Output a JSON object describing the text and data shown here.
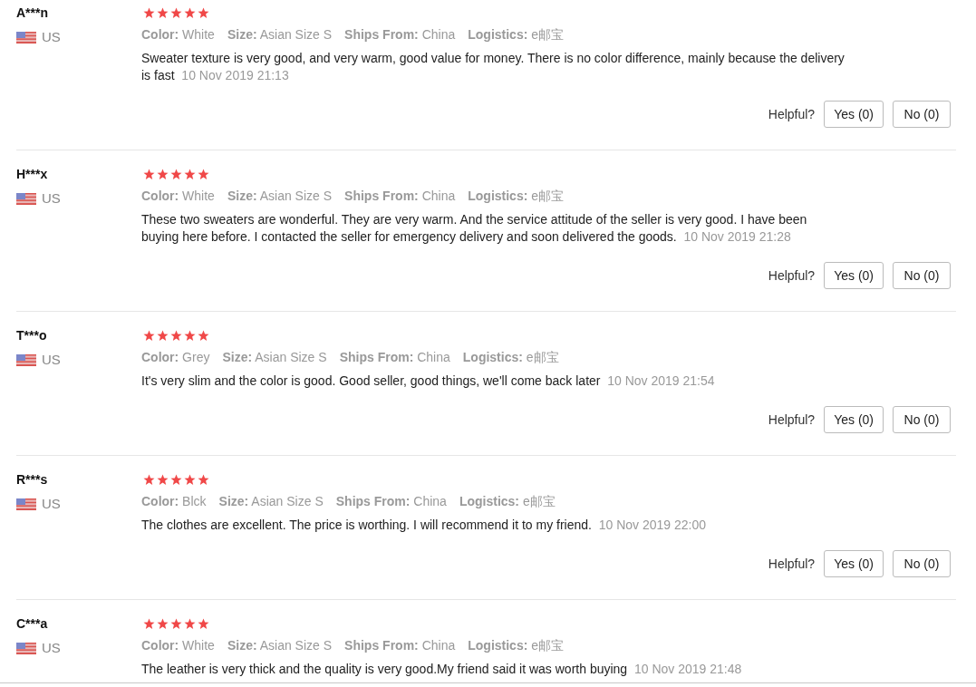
{
  "reviews": [
    {
      "name": "A***n",
      "country": "US",
      "stars": 5,
      "attributes": [
        {
          "label": "Color:",
          "value": "White"
        },
        {
          "label": "Size:",
          "value": "Asian Size S"
        },
        {
          "label": "Ships From:",
          "value": "China"
        },
        {
          "label": "Logistics:",
          "value": "e邮宝"
        }
      ],
      "text": "Sweater texture is very good, and very warm, good value for money. There is no color difference, mainly because the delivery is fast",
      "date": "10 Nov 2019 21:13",
      "helpful": {
        "prompt": "Helpful?",
        "yes": "Yes (0)",
        "no": "No (0)"
      }
    },
    {
      "name": "H***x",
      "country": "US",
      "stars": 5,
      "attributes": [
        {
          "label": "Color:",
          "value": "White"
        },
        {
          "label": "Size:",
          "value": "Asian Size S"
        },
        {
          "label": "Ships From:",
          "value": "China"
        },
        {
          "label": "Logistics:",
          "value": "e邮宝"
        }
      ],
      "text": "These two sweaters are wonderful. They are very warm. And the service attitude of the seller is very good. I have been buying here before. I contacted the seller for emergency delivery and soon delivered the goods.",
      "date": "10 Nov 2019 21:28",
      "helpful": {
        "prompt": "Helpful?",
        "yes": "Yes (0)",
        "no": "No (0)"
      }
    },
    {
      "name": "T***o",
      "country": "US",
      "stars": 5,
      "attributes": [
        {
          "label": "Color:",
          "value": "Grey"
        },
        {
          "label": "Size:",
          "value": "Asian Size S"
        },
        {
          "label": "Ships From:",
          "value": "China"
        },
        {
          "label": "Logistics:",
          "value": "e邮宝"
        }
      ],
      "text": "It's very slim and the color is good. Good seller, good things, we'll come back later",
      "date": "10 Nov 2019 21:54",
      "helpful": {
        "prompt": "Helpful?",
        "yes": "Yes (0)",
        "no": "No (0)"
      }
    },
    {
      "name": "R***s",
      "country": "US",
      "stars": 5,
      "attributes": [
        {
          "label": "Color:",
          "value": "Blck"
        },
        {
          "label": "Size:",
          "value": "Asian Size S"
        },
        {
          "label": "Ships From:",
          "value": "China"
        },
        {
          "label": "Logistics:",
          "value": "e邮宝"
        }
      ],
      "text": "The clothes are excellent. The price is worthing. I will recommend it to my friend.",
      "date": "10 Nov 2019 22:00",
      "helpful": {
        "prompt": "Helpful?",
        "yes": "Yes (0)",
        "no": "No (0)"
      }
    },
    {
      "name": "C***a",
      "country": "US",
      "stars": 5,
      "attributes": [
        {
          "label": "Color:",
          "value": "White"
        },
        {
          "label": "Size:",
          "value": "Asian Size S"
        },
        {
          "label": "Ships From:",
          "value": "China"
        },
        {
          "label": "Logistics:",
          "value": "e邮宝"
        }
      ],
      "text": "The leather is very thick and the quality is very good.My friend said it was worth buying",
      "date": "10 Nov 2019 21:48"
    }
  ]
}
